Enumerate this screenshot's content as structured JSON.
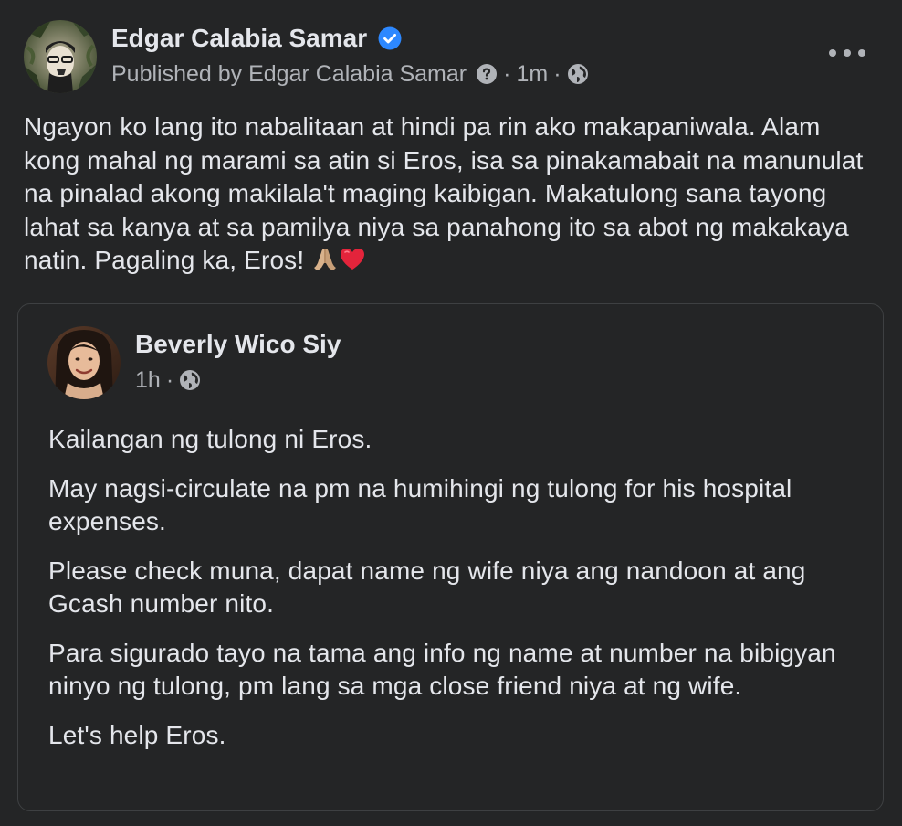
{
  "post": {
    "author": "Edgar Calabia Samar",
    "verified": true,
    "meta": {
      "published_by_label": "Published by Edgar Calabia Samar",
      "separator": "·",
      "time": "1m"
    },
    "text_before_emoji": "Ngayon ko lang ito nabalitaan at hindi pa rin ako makapaniwala. Alam kong mahal ng marami sa atin si Eros, isa sa pinakamabait na manunulat na pinalad akong makilala't maging kaibigan. Makatulong sana tayong lahat sa kanya at sa pamilya niya sa panahong ito sa abot ng makakaya natin. Pagaling ka, Eros! ",
    "emojis": [
      "folded-hands",
      "red-heart"
    ]
  },
  "shared": {
    "author": "Beverly Wico Siy",
    "meta": {
      "time": "1h",
      "separator": "·"
    },
    "paragraphs": [
      "Kailangan ng tulong ni Eros.",
      "May nagsi-circulate na pm na humihingi ng tulong for his hospital expenses.",
      "Please check muna, dapat name ng wife niya ang nandoon at ang Gcash number nito.",
      "Para sigurado tayo na tama ang info ng name at number na bibigyan ninyo ng tulong, pm lang sa mga close friend niya at ng wife.",
      "Let's help Eros."
    ]
  },
  "icons": {
    "verified": "verified-badge-icon",
    "question": "question-icon",
    "globe": "globe-icon",
    "more": "more-options-icon"
  },
  "colors": {
    "background": "#242526",
    "primary_text": "#e4e6eb",
    "secondary_text": "#b0b3b8",
    "verified_blue": "#2d88ff",
    "border": "#3e4042"
  }
}
